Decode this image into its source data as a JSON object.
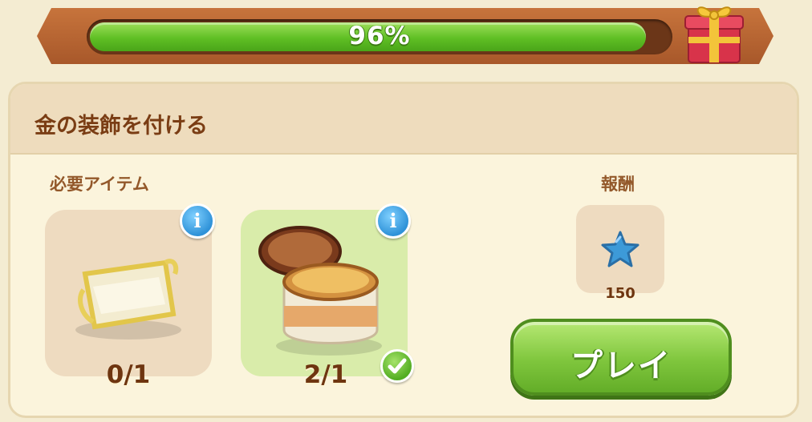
{
  "progress": {
    "percent_text": "96%",
    "fraction": 0.96
  },
  "quest": {
    "title": "金の装飾を付ける",
    "required_label": "必要アイテム",
    "reward_label": "報酬"
  },
  "items": [
    {
      "name": "cloth-roll",
      "count": "0/1",
      "complete": false,
      "info_glyph": "i"
    },
    {
      "name": "polish-jar",
      "count": "2/1",
      "complete": true,
      "info_glyph": "i"
    }
  ],
  "reward": {
    "icon": "blue-star-icon",
    "value": "150"
  },
  "play_button": {
    "label": "プレイ"
  },
  "colors": {
    "progress_green": "#5fbf24",
    "frame_brown": "#b8622f",
    "title_brown": "#7a3d14",
    "info_blue": "#2f92d8",
    "play_green": "#7fc63d"
  }
}
